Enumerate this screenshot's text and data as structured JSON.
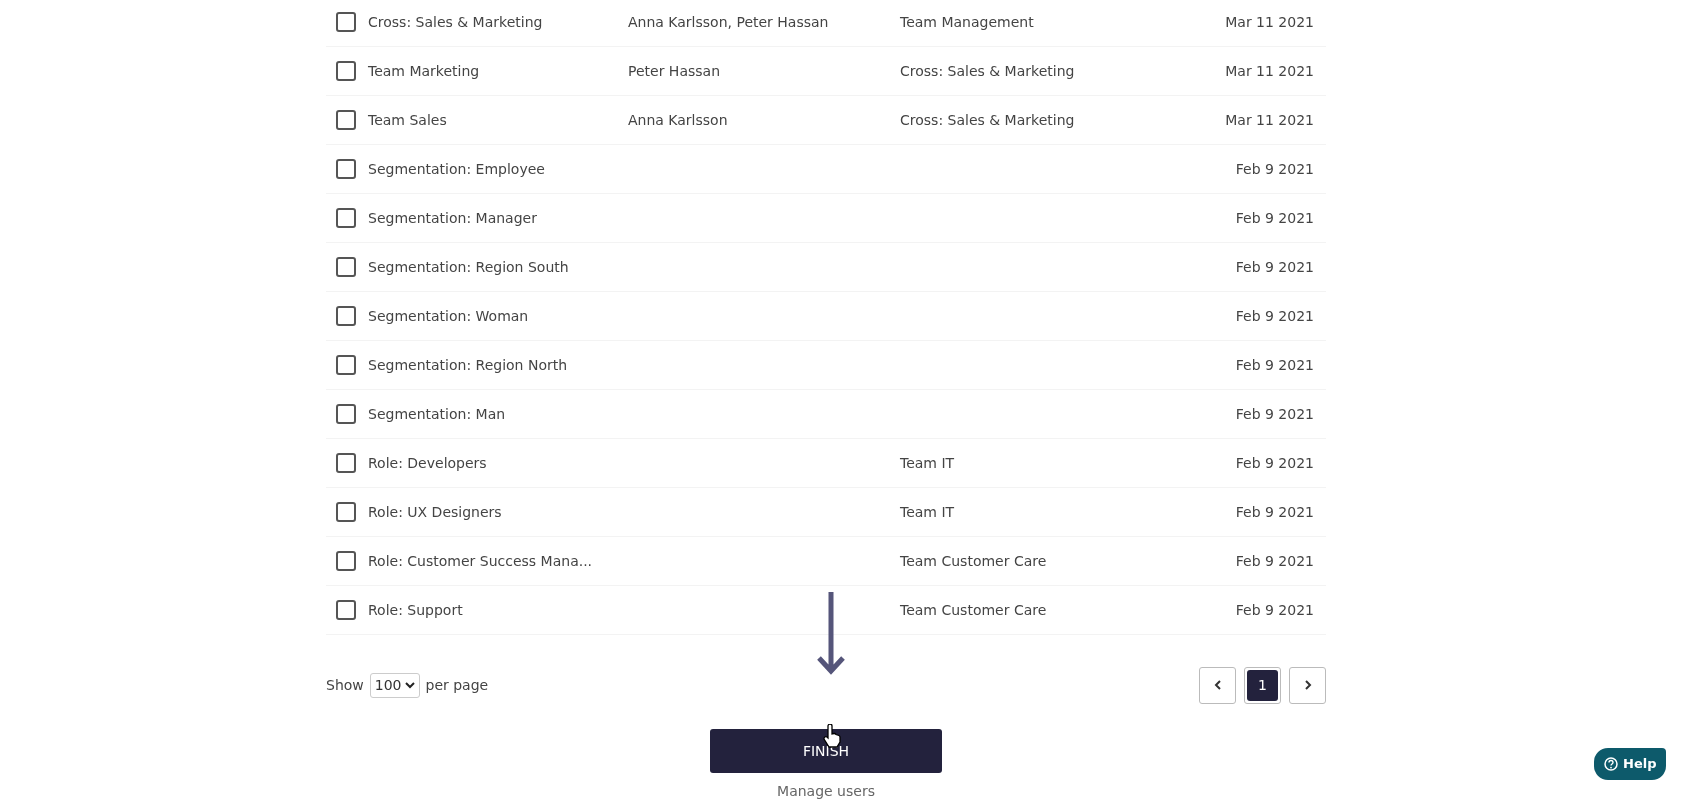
{
  "rows": [
    {
      "name": "Cross: Sales & Marketing",
      "members": "Anna Karlsson, Peter Hassan",
      "parent": "Team Management",
      "date": "Mar 11 2021",
      "checked": false
    },
    {
      "name": "Team Marketing",
      "members": "Peter Hassan",
      "parent": "Cross: Sales & Marketing",
      "date": "Mar 11 2021",
      "checked": false
    },
    {
      "name": "Team Sales",
      "members": "Anna Karlsson",
      "parent": "Cross: Sales & Marketing",
      "date": "Mar 11 2021",
      "checked": false
    },
    {
      "name": "Segmentation: Employee",
      "date": "Feb 9 2021",
      "checked": false
    },
    {
      "name": "Segmentation: Manager",
      "date": "Feb 9 2021",
      "checked": false
    },
    {
      "name": "Segmentation: Region South",
      "date": "Feb 9 2021",
      "checked": false
    },
    {
      "name": "Segmentation: Woman",
      "date": "Feb 9 2021",
      "checked": false
    },
    {
      "name": "Segmentation: Region North",
      "date": "Feb 9 2021",
      "checked": false
    },
    {
      "name": "Segmentation: Man",
      "date": "Feb 9 2021",
      "checked": false
    },
    {
      "name": "Role: Developers",
      "parent": "Team IT",
      "date": "Feb 9 2021",
      "checked": false
    },
    {
      "name": "Role: UX Designers",
      "parent": "Team IT",
      "date": "Feb 9 2021",
      "checked": false
    },
    {
      "name": "Role: Customer Success Mana...",
      "parent": "Team Customer Care",
      "date": "Feb 9 2021",
      "checked": false
    },
    {
      "name": "Role: Support",
      "parent": "Team Customer Care",
      "date": "Feb 9 2021",
      "checked": false
    }
  ],
  "pager": {
    "show_label": "Show",
    "per_page": "100",
    "per_page_label": "per page",
    "pages": [
      {
        "label": "1",
        "selected": true
      }
    ]
  },
  "finish_button": "FINISH",
  "manage_link": "Manage users",
  "help_button": "Help"
}
